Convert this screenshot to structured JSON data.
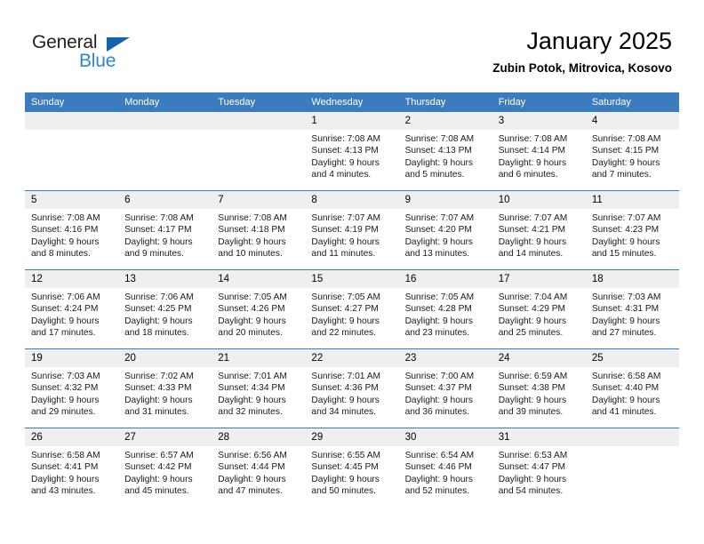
{
  "logo": {
    "word1": "General",
    "word2": "Blue",
    "triangle_color": "#1464ab",
    "word2_color": "#2d86d0"
  },
  "header": {
    "title": "January 2025",
    "subtitle": "Zubin Potok, Mitrovica, Kosovo"
  },
  "calendar": {
    "header_bg": "#3a7cbe",
    "daynum_bg": "#efefef",
    "weekdays": [
      "Sunday",
      "Monday",
      "Tuesday",
      "Wednesday",
      "Thursday",
      "Friday",
      "Saturday"
    ],
    "weeks": [
      [
        {
          "day": "",
          "empty": true
        },
        {
          "day": "",
          "empty": true
        },
        {
          "day": "",
          "empty": true
        },
        {
          "day": "1",
          "sunrise": "Sunrise: 7:08 AM",
          "sunset": "Sunset: 4:13 PM",
          "daylight1": "Daylight: 9 hours",
          "daylight2": "and 4 minutes."
        },
        {
          "day": "2",
          "sunrise": "Sunrise: 7:08 AM",
          "sunset": "Sunset: 4:13 PM",
          "daylight1": "Daylight: 9 hours",
          "daylight2": "and 5 minutes."
        },
        {
          "day": "3",
          "sunrise": "Sunrise: 7:08 AM",
          "sunset": "Sunset: 4:14 PM",
          "daylight1": "Daylight: 9 hours",
          "daylight2": "and 6 minutes."
        },
        {
          "day": "4",
          "sunrise": "Sunrise: 7:08 AM",
          "sunset": "Sunset: 4:15 PM",
          "daylight1": "Daylight: 9 hours",
          "daylight2": "and 7 minutes."
        }
      ],
      [
        {
          "day": "5",
          "sunrise": "Sunrise: 7:08 AM",
          "sunset": "Sunset: 4:16 PM",
          "daylight1": "Daylight: 9 hours",
          "daylight2": "and 8 minutes."
        },
        {
          "day": "6",
          "sunrise": "Sunrise: 7:08 AM",
          "sunset": "Sunset: 4:17 PM",
          "daylight1": "Daylight: 9 hours",
          "daylight2": "and 9 minutes."
        },
        {
          "day": "7",
          "sunrise": "Sunrise: 7:08 AM",
          "sunset": "Sunset: 4:18 PM",
          "daylight1": "Daylight: 9 hours",
          "daylight2": "and 10 minutes."
        },
        {
          "day": "8",
          "sunrise": "Sunrise: 7:07 AM",
          "sunset": "Sunset: 4:19 PM",
          "daylight1": "Daylight: 9 hours",
          "daylight2": "and 11 minutes."
        },
        {
          "day": "9",
          "sunrise": "Sunrise: 7:07 AM",
          "sunset": "Sunset: 4:20 PM",
          "daylight1": "Daylight: 9 hours",
          "daylight2": "and 13 minutes."
        },
        {
          "day": "10",
          "sunrise": "Sunrise: 7:07 AM",
          "sunset": "Sunset: 4:21 PM",
          "daylight1": "Daylight: 9 hours",
          "daylight2": "and 14 minutes."
        },
        {
          "day": "11",
          "sunrise": "Sunrise: 7:07 AM",
          "sunset": "Sunset: 4:23 PM",
          "daylight1": "Daylight: 9 hours",
          "daylight2": "and 15 minutes."
        }
      ],
      [
        {
          "day": "12",
          "sunrise": "Sunrise: 7:06 AM",
          "sunset": "Sunset: 4:24 PM",
          "daylight1": "Daylight: 9 hours",
          "daylight2": "and 17 minutes."
        },
        {
          "day": "13",
          "sunrise": "Sunrise: 7:06 AM",
          "sunset": "Sunset: 4:25 PM",
          "daylight1": "Daylight: 9 hours",
          "daylight2": "and 18 minutes."
        },
        {
          "day": "14",
          "sunrise": "Sunrise: 7:05 AM",
          "sunset": "Sunset: 4:26 PM",
          "daylight1": "Daylight: 9 hours",
          "daylight2": "and 20 minutes."
        },
        {
          "day": "15",
          "sunrise": "Sunrise: 7:05 AM",
          "sunset": "Sunset: 4:27 PM",
          "daylight1": "Daylight: 9 hours",
          "daylight2": "and 22 minutes."
        },
        {
          "day": "16",
          "sunrise": "Sunrise: 7:05 AM",
          "sunset": "Sunset: 4:28 PM",
          "daylight1": "Daylight: 9 hours",
          "daylight2": "and 23 minutes."
        },
        {
          "day": "17",
          "sunrise": "Sunrise: 7:04 AM",
          "sunset": "Sunset: 4:29 PM",
          "daylight1": "Daylight: 9 hours",
          "daylight2": "and 25 minutes."
        },
        {
          "day": "18",
          "sunrise": "Sunrise: 7:03 AM",
          "sunset": "Sunset: 4:31 PM",
          "daylight1": "Daylight: 9 hours",
          "daylight2": "and 27 minutes."
        }
      ],
      [
        {
          "day": "19",
          "sunrise": "Sunrise: 7:03 AM",
          "sunset": "Sunset: 4:32 PM",
          "daylight1": "Daylight: 9 hours",
          "daylight2": "and 29 minutes."
        },
        {
          "day": "20",
          "sunrise": "Sunrise: 7:02 AM",
          "sunset": "Sunset: 4:33 PM",
          "daylight1": "Daylight: 9 hours",
          "daylight2": "and 31 minutes."
        },
        {
          "day": "21",
          "sunrise": "Sunrise: 7:01 AM",
          "sunset": "Sunset: 4:34 PM",
          "daylight1": "Daylight: 9 hours",
          "daylight2": "and 32 minutes."
        },
        {
          "day": "22",
          "sunrise": "Sunrise: 7:01 AM",
          "sunset": "Sunset: 4:36 PM",
          "daylight1": "Daylight: 9 hours",
          "daylight2": "and 34 minutes."
        },
        {
          "day": "23",
          "sunrise": "Sunrise: 7:00 AM",
          "sunset": "Sunset: 4:37 PM",
          "daylight1": "Daylight: 9 hours",
          "daylight2": "and 36 minutes."
        },
        {
          "day": "24",
          "sunrise": "Sunrise: 6:59 AM",
          "sunset": "Sunset: 4:38 PM",
          "daylight1": "Daylight: 9 hours",
          "daylight2": "and 39 minutes."
        },
        {
          "day": "25",
          "sunrise": "Sunrise: 6:58 AM",
          "sunset": "Sunset: 4:40 PM",
          "daylight1": "Daylight: 9 hours",
          "daylight2": "and 41 minutes."
        }
      ],
      [
        {
          "day": "26",
          "sunrise": "Sunrise: 6:58 AM",
          "sunset": "Sunset: 4:41 PM",
          "daylight1": "Daylight: 9 hours",
          "daylight2": "and 43 minutes."
        },
        {
          "day": "27",
          "sunrise": "Sunrise: 6:57 AM",
          "sunset": "Sunset: 4:42 PM",
          "daylight1": "Daylight: 9 hours",
          "daylight2": "and 45 minutes."
        },
        {
          "day": "28",
          "sunrise": "Sunrise: 6:56 AM",
          "sunset": "Sunset: 4:44 PM",
          "daylight1": "Daylight: 9 hours",
          "daylight2": "and 47 minutes."
        },
        {
          "day": "29",
          "sunrise": "Sunrise: 6:55 AM",
          "sunset": "Sunset: 4:45 PM",
          "daylight1": "Daylight: 9 hours",
          "daylight2": "and 50 minutes."
        },
        {
          "day": "30",
          "sunrise": "Sunrise: 6:54 AM",
          "sunset": "Sunset: 4:46 PM",
          "daylight1": "Daylight: 9 hours",
          "daylight2": "and 52 minutes."
        },
        {
          "day": "31",
          "sunrise": "Sunrise: 6:53 AM",
          "sunset": "Sunset: 4:47 PM",
          "daylight1": "Daylight: 9 hours",
          "daylight2": "and 54 minutes."
        },
        {
          "day": "",
          "empty": true
        }
      ]
    ]
  }
}
